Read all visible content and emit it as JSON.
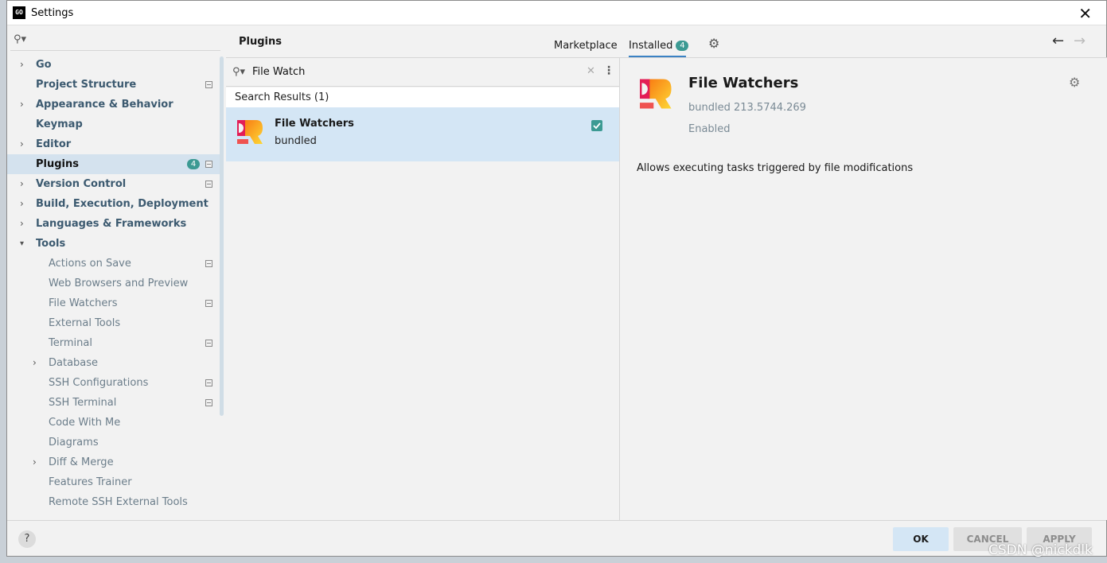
{
  "window": {
    "title": "Settings",
    "app_logo": "GO",
    "close_icon": "close-icon"
  },
  "sidebar": {
    "search_value": "",
    "items": [
      {
        "label": "Go",
        "expandable": true,
        "level": 0,
        "has_config": false
      },
      {
        "label": "Project Structure",
        "expandable": false,
        "level": 0,
        "has_config": true
      },
      {
        "label": "Appearance & Behavior",
        "expandable": true,
        "level": 0,
        "has_config": false
      },
      {
        "label": "Keymap",
        "expandable": false,
        "level": 0,
        "has_config": false
      },
      {
        "label": "Editor",
        "expandable": true,
        "level": 0,
        "has_config": false
      },
      {
        "label": "Plugins",
        "expandable": false,
        "level": 0,
        "has_config": true,
        "badge": "4",
        "selected": true
      },
      {
        "label": "Version Control",
        "expandable": true,
        "level": 0,
        "has_config": true
      },
      {
        "label": "Build, Execution, Deployment",
        "expandable": true,
        "level": 0,
        "has_config": false
      },
      {
        "label": "Languages & Frameworks",
        "expandable": true,
        "level": 0,
        "has_config": false
      },
      {
        "label": "Tools",
        "expandable": true,
        "expanded": true,
        "level": 0,
        "has_config": false
      },
      {
        "label": "Actions on Save",
        "expandable": false,
        "level": 1,
        "has_config": true
      },
      {
        "label": "Web Browsers and Preview",
        "expandable": false,
        "level": 1,
        "has_config": false
      },
      {
        "label": "File Watchers",
        "expandable": false,
        "level": 1,
        "has_config": true
      },
      {
        "label": "External Tools",
        "expandable": false,
        "level": 1,
        "has_config": false
      },
      {
        "label": "Terminal",
        "expandable": false,
        "level": 1,
        "has_config": true
      },
      {
        "label": "Database",
        "expandable": true,
        "level": 1,
        "has_config": false
      },
      {
        "label": "SSH Configurations",
        "expandable": false,
        "level": 1,
        "has_config": true
      },
      {
        "label": "SSH Terminal",
        "expandable": false,
        "level": 1,
        "has_config": true
      },
      {
        "label": "Code With Me",
        "expandable": false,
        "level": 1,
        "has_config": false
      },
      {
        "label": "Diagrams",
        "expandable": false,
        "level": 1,
        "has_config": false
      },
      {
        "label": "Diff & Merge",
        "expandable": true,
        "level": 1,
        "has_config": false
      },
      {
        "label": "Features Trainer",
        "expandable": false,
        "level": 1,
        "has_config": false
      },
      {
        "label": "Remote SSH External Tools",
        "expandable": false,
        "level": 1,
        "has_config": false
      }
    ]
  },
  "plugins": {
    "title": "Plugins",
    "tabs": {
      "marketplace": "Marketplace",
      "installed": "Installed",
      "installed_count": "4"
    },
    "search": {
      "value": "File Watch"
    },
    "results_header": "Search Results (1)",
    "results": [
      {
        "name": "File Watchers",
        "subtitle": "bundled",
        "enabled": true
      }
    ],
    "detail": {
      "name": "File Watchers",
      "version": "bundled 213.5744.269",
      "status": "Enabled",
      "description": "Allows executing tasks triggered by file modifications"
    }
  },
  "footer": {
    "help": "?",
    "ok": "OK",
    "cancel": "CANCEL",
    "apply": "APPLY"
  },
  "watermark": "CSDN @nickdlk",
  "colors": {
    "accent": "#3c9a93",
    "selection": "#d4e2ee",
    "result_selection": "#d4e6f5"
  }
}
